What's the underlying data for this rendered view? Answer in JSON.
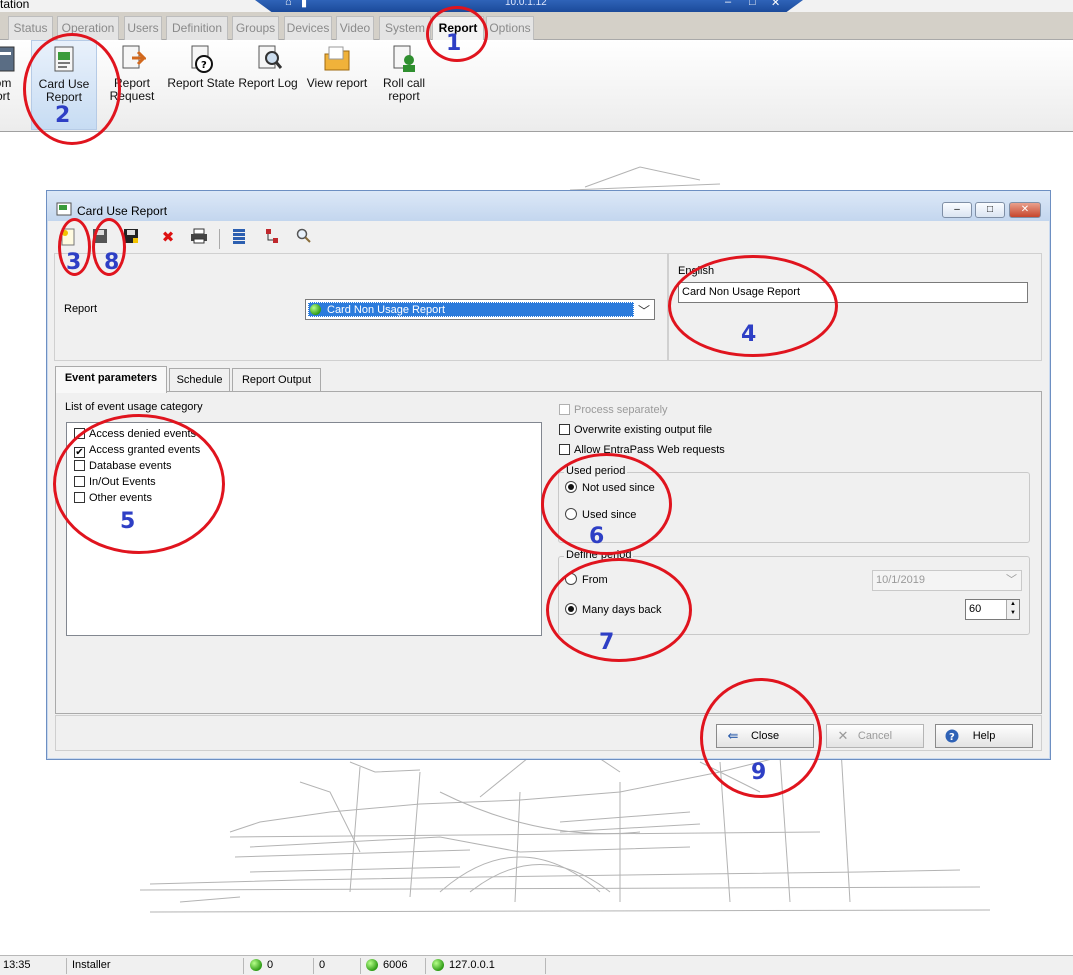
{
  "app": {
    "window_title": "tation",
    "remote_ip": "10.0.1.12"
  },
  "ribbon": {
    "tabs": [
      "Status",
      "Operation",
      "Users",
      "Definition",
      "Groups",
      "Devices",
      "Video",
      "System",
      "Report",
      "Options"
    ],
    "active_tab": "Report",
    "buttons": [
      {
        "line1": "om",
        "line2": "ort"
      },
      {
        "line1": "Card Use",
        "line2": "Report"
      },
      {
        "line1": "Report",
        "line2": "Request"
      },
      {
        "line1": "Report State",
        "line2": ""
      },
      {
        "line1": "Report Log",
        "line2": ""
      },
      {
        "line1": "View report",
        "line2": ""
      },
      {
        "line1": "Roll call",
        "line2": "report"
      }
    ]
  },
  "dialog": {
    "title": "Card Use Report",
    "report_label": "Report",
    "report_selected": "Card Non Usage Report",
    "english_label": "English",
    "english_value": "Card Non Usage Report",
    "tabs": [
      "Event parameters",
      "Schedule",
      "Report Output"
    ],
    "active_tab": "Event parameters",
    "list_caption": "List of event usage category",
    "event_categories": [
      {
        "label": "Access denied events",
        "checked": false
      },
      {
        "label": "Access granted events",
        "checked": true
      },
      {
        "label": "Database events",
        "checked": false
      },
      {
        "label": "In/Out Events",
        "checked": false
      },
      {
        "label": "Other events",
        "checked": false
      }
    ],
    "options": {
      "process_separately": "Process separately",
      "overwrite": "Overwrite existing output file",
      "allow_web": "Allow EntraPass Web requests"
    },
    "used_period": {
      "title": "Used period",
      "not_used_since": "Not used since",
      "used_since": "Used since",
      "selected": "Not used since"
    },
    "define_period": {
      "title": "Define period",
      "from_label": "From",
      "from_date": "10/1/2019",
      "many_days_label": "Many days back",
      "days_value": "60",
      "selected": "Many days back"
    },
    "buttons": {
      "close": "Close",
      "cancel": "Cancel",
      "help": "Help"
    }
  },
  "annotations": [
    "1",
    "2",
    "3",
    "8",
    "4",
    "5",
    "6",
    "7",
    "9"
  ],
  "statusbar": {
    "time": "13:35",
    "user": "Installer",
    "count1": "0",
    "count2": "0",
    "port": "6006",
    "host": "127.0.0.1"
  },
  "colors": {
    "annotation_red": "#e0141e",
    "annotation_blue": "#2e3fc5",
    "selection_blue": "#2b7bdc",
    "status_green": "#2f9c16"
  }
}
